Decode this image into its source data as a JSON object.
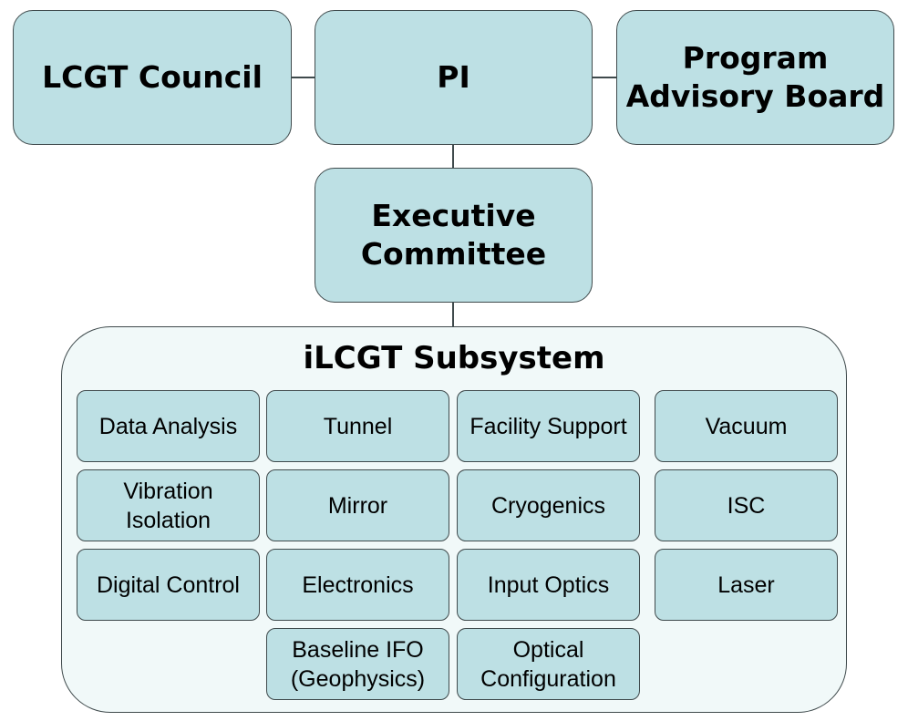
{
  "top_row": {
    "council": "LCGT Council",
    "pi": "PI",
    "advisory_line1": "Program",
    "advisory_line2": "Advisory Board"
  },
  "executive": {
    "line1": "Executive",
    "line2": "Committee"
  },
  "subsystem": {
    "title": "iLCGT Subsystem",
    "cells": {
      "data_analysis": "Data Analysis",
      "tunnel": "Tunnel",
      "facility_support": "Facility Support",
      "vacuum": "Vacuum",
      "vibration_isolation_1": "Vibration",
      "vibration_isolation_2": "Isolation",
      "mirror": "Mirror",
      "cryogenics": "Cryogenics",
      "isc": "ISC",
      "digital_control": "Digital Control",
      "electronics": "Electronics",
      "input_optics": "Input Optics",
      "laser": "Laser",
      "baseline_ifo_1": "Baseline IFO",
      "baseline_ifo_2": "(Geophysics)",
      "optical_config_1": "Optical",
      "optical_config_2": "Configuration"
    }
  },
  "colors": {
    "box_fill": "#bde0e4",
    "container_fill": "#f1f9f9",
    "border": "#3f4a4c"
  }
}
